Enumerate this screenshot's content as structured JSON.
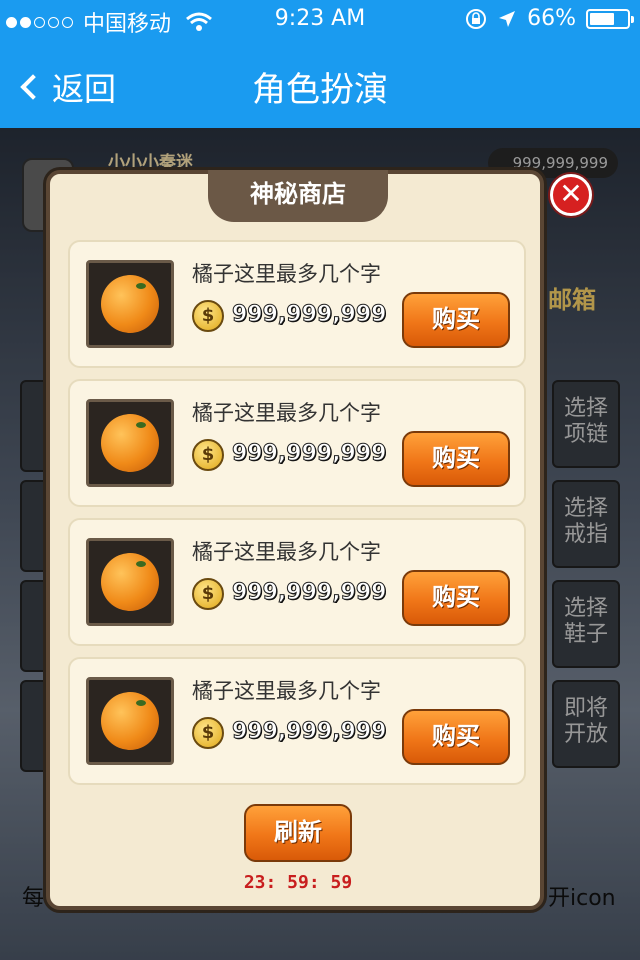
{
  "status_bar": {
    "carrier": "中国移动",
    "time": "9:23 AM",
    "battery": "66%",
    "battery_level": 0.66,
    "signal_bars_filled": 2,
    "signal_bars_total": 5
  },
  "nav": {
    "back_label": "返回",
    "title": "角色扮演"
  },
  "background": {
    "player_name": "小小小秦迷",
    "coins": "999,999,999",
    "mail_label": "邮箱",
    "side_buttons": [
      "选择项链",
      "选择戒指",
      "选择鞋子",
      "即将开放"
    ],
    "bottom_left_text": "每",
    "bottom_right_text": "开icon"
  },
  "shop": {
    "title": "神秘商店",
    "close_label": "✕",
    "items": [
      {
        "name": "橘子这里最多几个字",
        "price": "999,999,999",
        "buy_label": "购买"
      },
      {
        "name": "橘子这里最多几个字",
        "price": "999,999,999",
        "buy_label": "购买"
      },
      {
        "name": "橘子这里最多几个字",
        "price": "999,999,999",
        "buy_label": "购买"
      },
      {
        "name": "橘子这里最多几个字",
        "price": "999,999,999",
        "buy_label": "购买"
      }
    ],
    "coin_symbol": "$",
    "refresh_label": "刷新",
    "timer": "23: 59: 59"
  },
  "colors": {
    "nav_blue": "#1a9bf0",
    "button_orange": "#f07618",
    "timer_red": "#c81e1e",
    "close_red": "#d62020"
  }
}
